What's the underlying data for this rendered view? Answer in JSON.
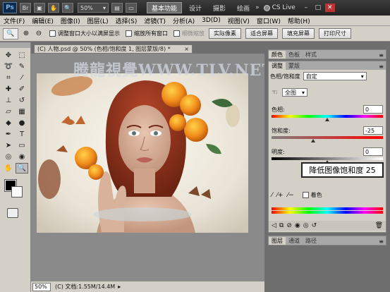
{
  "titlebar": {
    "logo": "Ps",
    "zoom": "50%",
    "workspaces": [
      "基本功能",
      "设计",
      "摄影",
      "绘画"
    ],
    "more": "»",
    "cs_live": "CS Live"
  },
  "menu": [
    "文件(F)",
    "编辑(E)",
    "图像(I)",
    "图层(L)",
    "选择(S)",
    "滤镜(T)",
    "分析(A)",
    "3D(D)",
    "视图(V)",
    "窗口(W)",
    "帮助(H)"
  ],
  "options": {
    "chk_resize": "调整窗口大小以满屏显示",
    "chk_zoom_all": "缩放所有窗口",
    "chk_scrubby": "细微缩放",
    "btn_actual": "实际像素",
    "btn_fit": "适合屏幕",
    "btn_fill": "填充屏幕",
    "btn_print": "打印尺寸"
  },
  "document": {
    "tab_title": "(C) 人物.psd @ 50% (色相/饱和度 1, 图层蒙版/8) *",
    "watermark": "腾龍視覺WWW.TLV.NET",
    "zoom_field": "50%",
    "doc_info": "(C) 文档:1.55M/14.4M"
  },
  "panels": {
    "top_tabs": [
      "颜色",
      "色板",
      "样式"
    ],
    "adjust_tabs": [
      "调整",
      "蒙版"
    ],
    "adjust_title": "色相/饱和度",
    "preset": "自定",
    "channel": "全图",
    "hue_label": "色相:",
    "hue_value": "0",
    "hue_level": 0.5,
    "sat_label": "饱和度:",
    "sat_value": "-25",
    "sat_level": 0.375,
    "light_label": "明度:",
    "light_value": "0",
    "light_level": 0.5,
    "colorize_label": "着色",
    "bottom_tabs": [
      "图层",
      "通道",
      "路径"
    ]
  },
  "callout": "降低图像饱和度 25",
  "colors": {
    "hue_gradient": "linear-gradient(90deg,#f00,#ff0,#0f0,#0ff,#00f,#f0f,#f00)",
    "sat_gradient": "linear-gradient(90deg,#808080,#ff0000)",
    "light_gradient": "linear-gradient(90deg,#000,#808080,#fff)"
  }
}
